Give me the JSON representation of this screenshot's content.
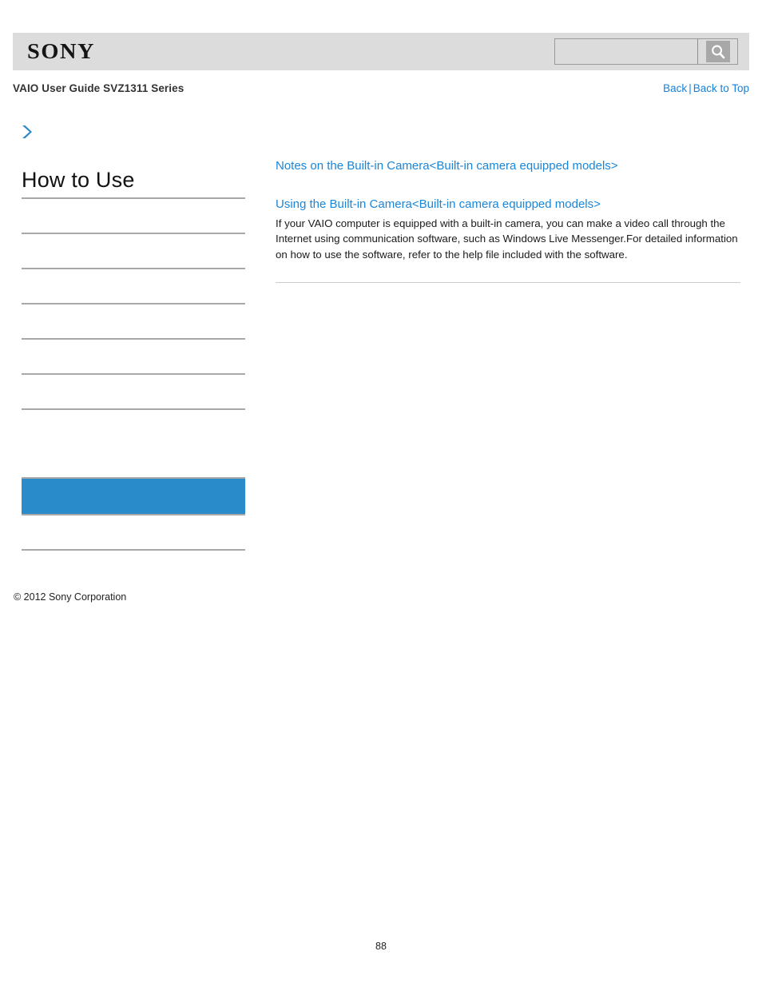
{
  "header": {
    "logo_text": "SONY",
    "search": {
      "value": "",
      "placeholder": "",
      "icon": "search-icon",
      "button_label": ""
    }
  },
  "breadcrumb": {
    "title": "VAIO User Guide SVZ1311 Series",
    "back_label": "Back",
    "separator": "|",
    "back_to_top_label": "Back to Top"
  },
  "sidebar": {
    "expand_icon": "chevron-right-icon",
    "heading": "How to Use",
    "items": [
      {
        "label": "",
        "selected": false
      },
      {
        "label": "",
        "selected": false
      },
      {
        "label": "",
        "selected": false
      },
      {
        "label": "",
        "selected": false
      },
      {
        "label": "",
        "selected": false
      },
      {
        "label": "",
        "selected": false
      },
      {
        "label": "",
        "selected": false
      },
      {
        "label": "",
        "selected": true
      },
      {
        "label": "",
        "selected": false
      }
    ],
    "copyright": "© 2012 Sony Corporation"
  },
  "main": {
    "links": [
      {
        "label": "Notes on the Built-in Camera<Built-in camera equipped models>"
      },
      {
        "label": "Using the Built-in Camera<Built-in camera equipped models>"
      }
    ],
    "body": "If your VAIO computer is equipped with a built-in camera, you can make a video call through the Internet using communication software, such as Windows Live Messenger.For detailed information on how to use the software, refer to the help file included with the software."
  },
  "footer": {
    "page_number": "88"
  },
  "colors": {
    "header_bg": "#dcdcdc",
    "link_blue": "#1a86d9",
    "nav_blue": "#1a7fd4",
    "selected_blue": "#2a8bcb",
    "divider_gray": "#a8a8a8"
  }
}
